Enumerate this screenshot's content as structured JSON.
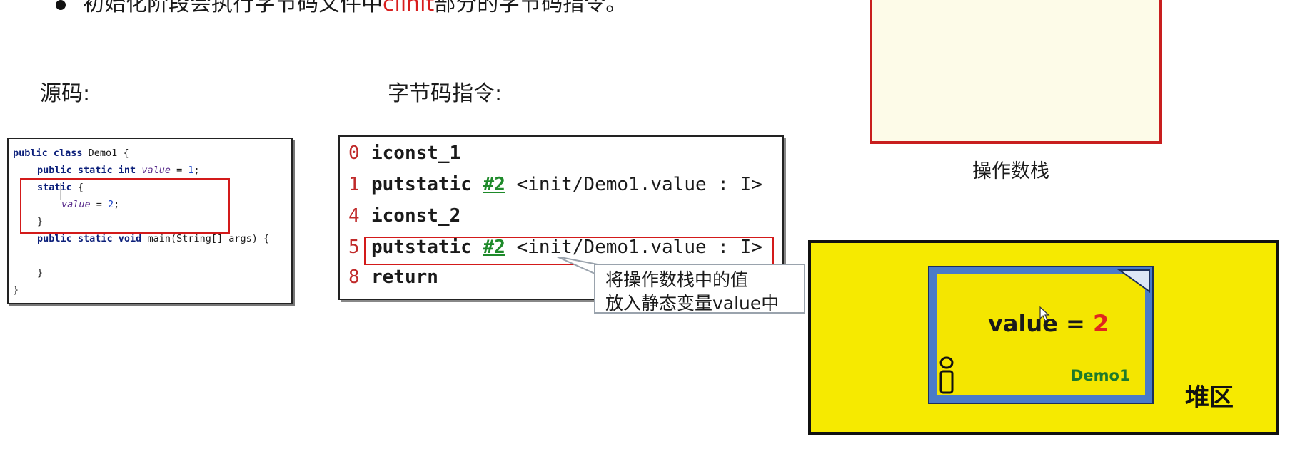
{
  "top_line": {
    "prefix": "初始化阶段会执行字节码文件中",
    "highlight": "clinit",
    "suffix": "部分的字节码指令。"
  },
  "labels": {
    "source": "源码:",
    "bytecode": "字节码指令:",
    "operand_stack": "操作数栈",
    "heap": "堆区"
  },
  "source_code": {
    "line1_kw": "public class",
    "line1_rest": " Demo1 {",
    "line2_kw": "public static int",
    "line2_var": "value",
    "line2_eq": " = ",
    "line2_num": "1",
    "line2_end": ";",
    "line3_kw": "static",
    "line3_rest": " {",
    "line4_var": "value",
    "line4_eq": " = ",
    "line4_num": "2",
    "line4_end": ";",
    "line5": "}",
    "line6_kw": "public static void",
    "line6_rest": " main(String[] args) {",
    "line7": "}",
    "line8": "}"
  },
  "bytecode": [
    {
      "ln": "0",
      "op": "iconst_1",
      "ref": "",
      "arg": ""
    },
    {
      "ln": "1",
      "op": "putstatic",
      "ref": "#2",
      "arg": "<init/Demo1.value : I>"
    },
    {
      "ln": "4",
      "op": "iconst_2",
      "ref": "",
      "arg": ""
    },
    {
      "ln": "5",
      "op": "putstatic",
      "ref": "#2",
      "arg": "<init/Demo1.value : I>"
    },
    {
      "ln": "8",
      "op": "return",
      "ref": "",
      "arg": ""
    }
  ],
  "callout": {
    "line1": "将操作数栈中的值",
    "line2": "放入静态变量value中"
  },
  "heap_object": {
    "label": "value = ",
    "value": "2",
    "class_name": "Demo1"
  },
  "colors": {
    "highlight_red": "#d81e1e",
    "heap_yellow": "#f6ea00",
    "doc_blue": "#4a7bc8",
    "ref_green": "#1e8a2a"
  }
}
